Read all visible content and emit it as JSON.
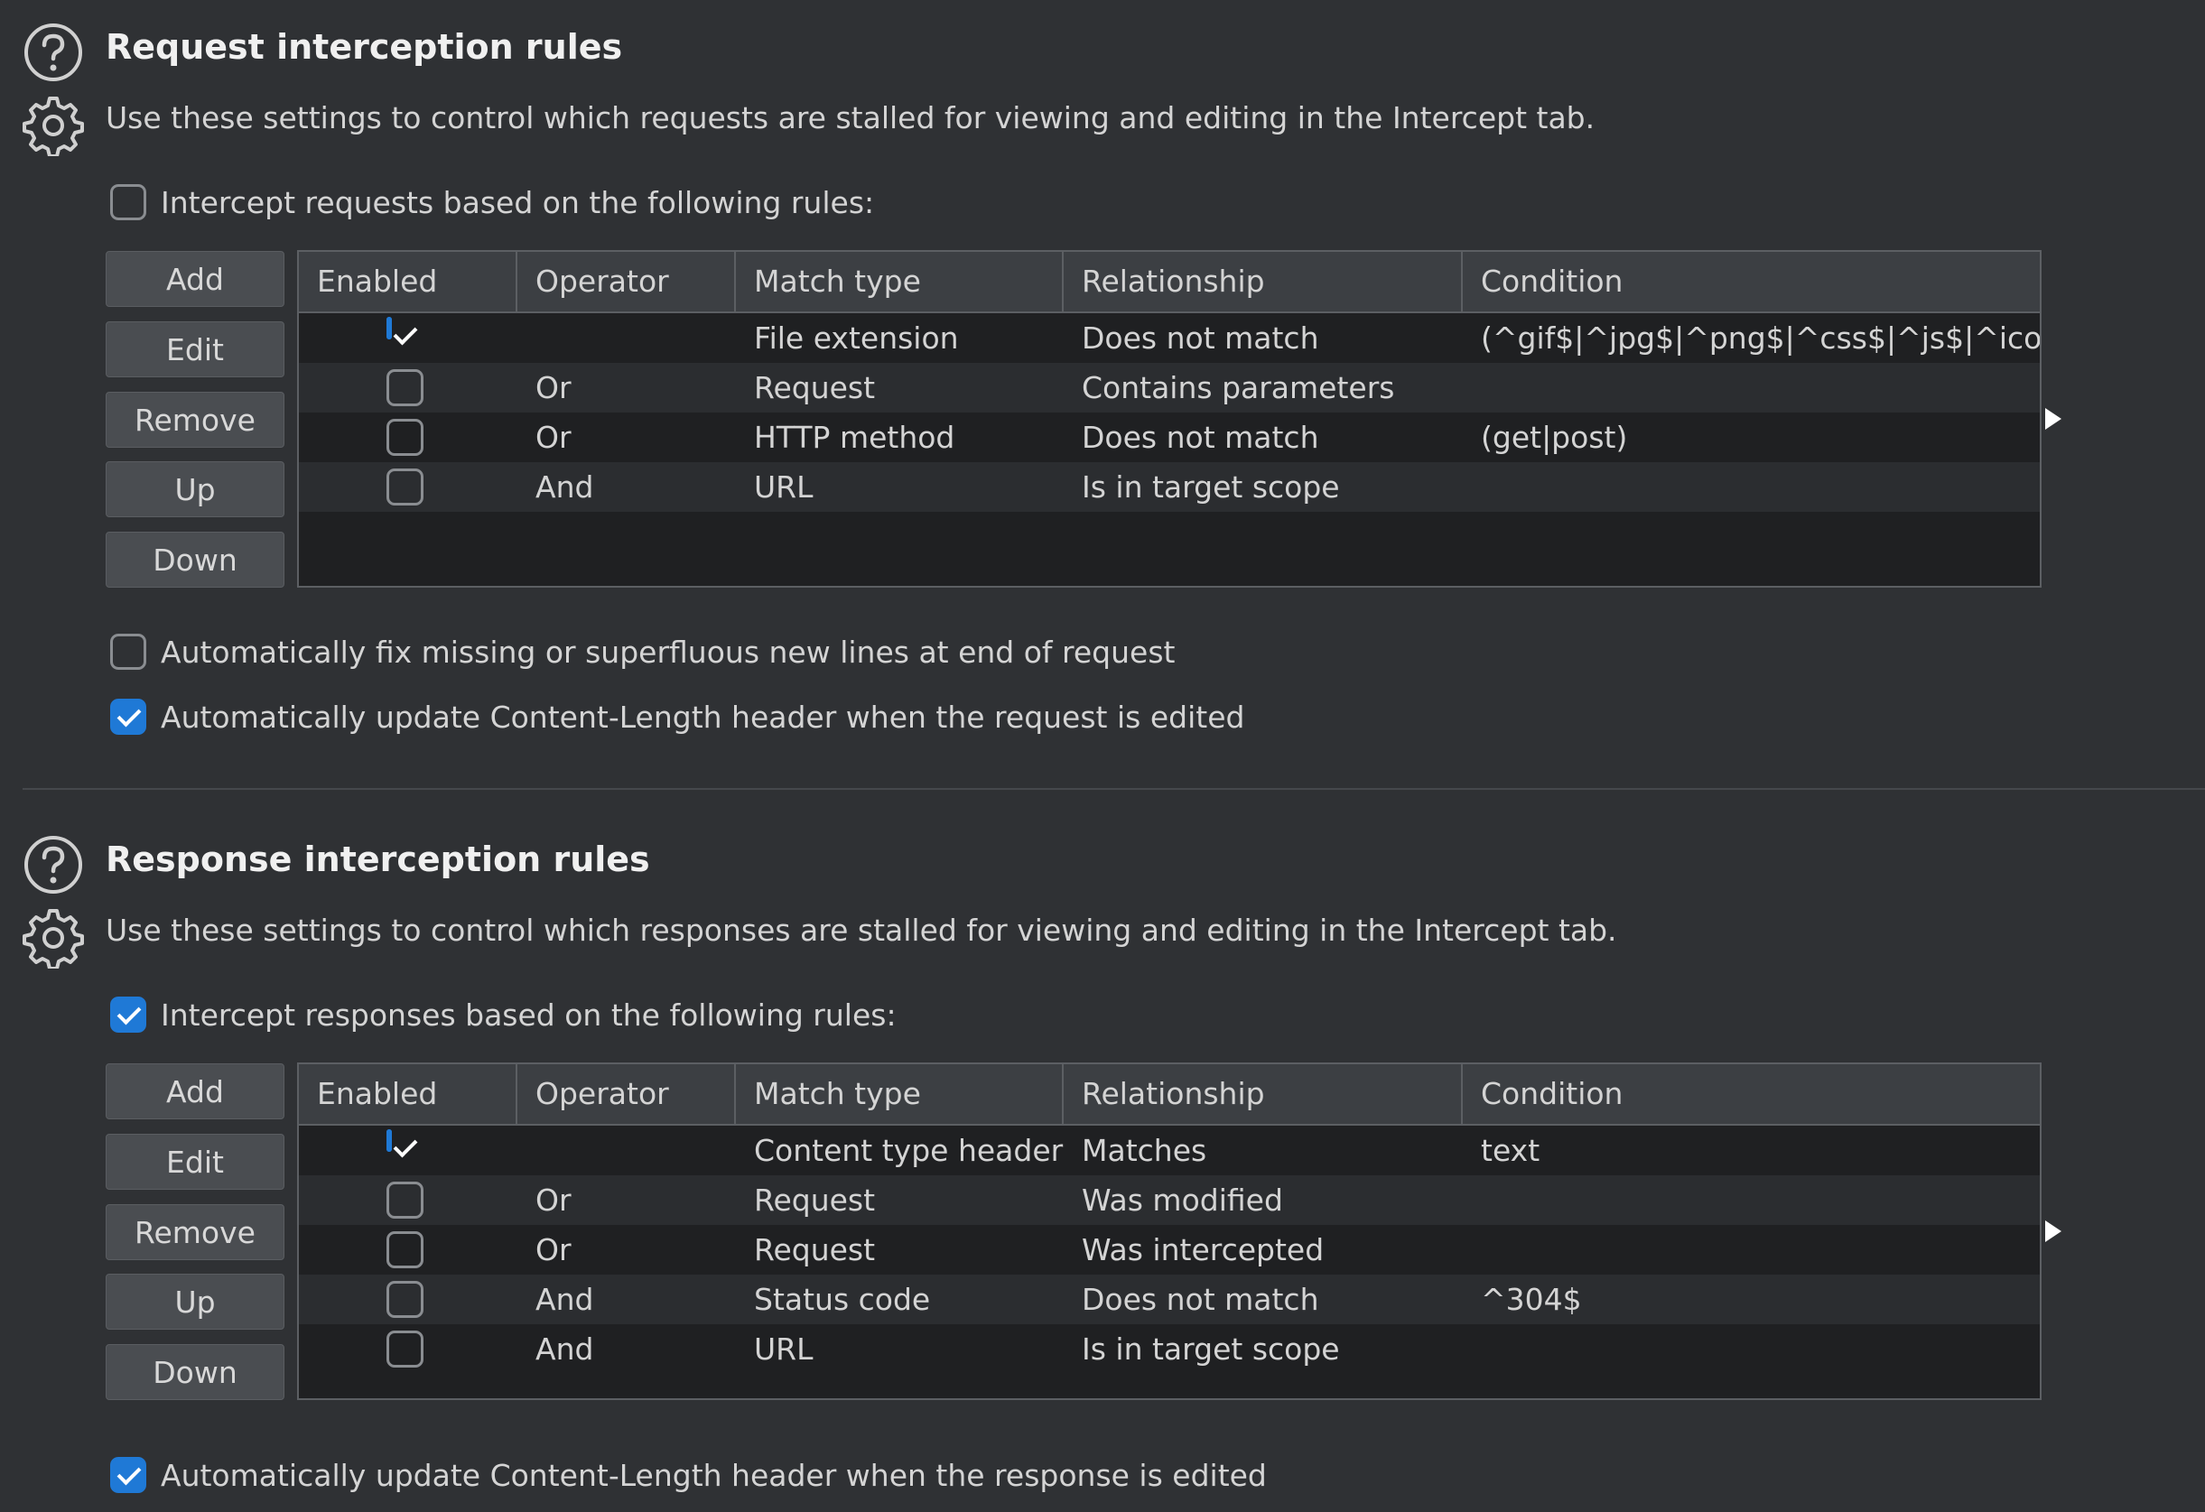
{
  "request": {
    "title": "Request interception rules",
    "description": "Use these settings to control which requests are stalled for viewing and editing in the Intercept tab.",
    "intercept_label": "Intercept requests based on the following rules:",
    "intercept_checked": false,
    "buttons": [
      "Add",
      "Edit",
      "Remove",
      "Up",
      "Down"
    ],
    "columns": [
      "Enabled",
      "Operator",
      "Match type",
      "Relationship",
      "Condition"
    ],
    "rows": [
      {
        "enabled": true,
        "operator": "",
        "match_type": "File extension",
        "relationship": "Does not match",
        "condition": "(^gif$|^jpg$|^png$|^css$|^js$|^ico$|..."
      },
      {
        "enabled": false,
        "operator": "Or",
        "match_type": "Request",
        "relationship": "Contains parameters",
        "condition": ""
      },
      {
        "enabled": false,
        "operator": "Or",
        "match_type": "HTTP method",
        "relationship": "Does not match",
        "condition": "(get|post)"
      },
      {
        "enabled": false,
        "operator": "And",
        "match_type": "URL",
        "relationship": "Is in target scope",
        "condition": ""
      }
    ],
    "options": [
      {
        "label": "Automatically fix missing or superfluous new lines at end of request",
        "checked": false
      },
      {
        "label": "Automatically update Content-Length header when the request is edited",
        "checked": true
      }
    ]
  },
  "response": {
    "title": "Response interception rules",
    "description": "Use these settings to control which responses are stalled for viewing and editing in the Intercept tab.",
    "intercept_label": "Intercept responses based on the following rules:",
    "intercept_checked": true,
    "buttons": [
      "Add",
      "Edit",
      "Remove",
      "Up",
      "Down"
    ],
    "columns": [
      "Enabled",
      "Operator",
      "Match type",
      "Relationship",
      "Condition"
    ],
    "rows": [
      {
        "enabled": true,
        "operator": "",
        "match_type": "Content type header",
        "relationship": "Matches",
        "condition": "text"
      },
      {
        "enabled": false,
        "operator": "Or",
        "match_type": "Request",
        "relationship": "Was modified",
        "condition": ""
      },
      {
        "enabled": false,
        "operator": "Or",
        "match_type": "Request",
        "relationship": "Was intercepted",
        "condition": ""
      },
      {
        "enabled": false,
        "operator": "And",
        "match_type": "Status code",
        "relationship": "Does not match",
        "condition": "^304$"
      },
      {
        "enabled": false,
        "operator": "And",
        "match_type": "URL",
        "relationship": "Is in target scope",
        "condition": ""
      }
    ],
    "options": [
      {
        "label": "Automatically update Content-Length header when the response is edited",
        "checked": true
      }
    ]
  },
  "icons": [
    "help-icon",
    "gear-icon",
    "expand-arrow-icon"
  ],
  "colors": {
    "background": "#2f3134",
    "table_background": "#1f2022",
    "accent": "#1f79d6"
  }
}
